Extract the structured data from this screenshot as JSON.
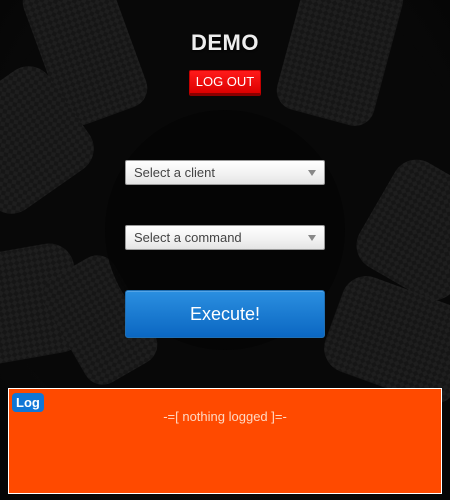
{
  "app": {
    "title": "DEMO",
    "logout_label": "LOG OUT"
  },
  "form": {
    "client_select": {
      "value": "Select a client"
    },
    "command_select": {
      "value": "Select a command"
    },
    "execute_label": "Execute!"
  },
  "log": {
    "badge": "Log",
    "message": "-=[ nothing logged ]=-"
  },
  "colors": {
    "logout": "#e60000",
    "execute": "#1676d0",
    "log_background": "#ff4a00",
    "log_badge": "#1076d6"
  },
  "icons": {
    "select_arrow": "chevron-down-icon",
    "background": "gear-icon"
  }
}
